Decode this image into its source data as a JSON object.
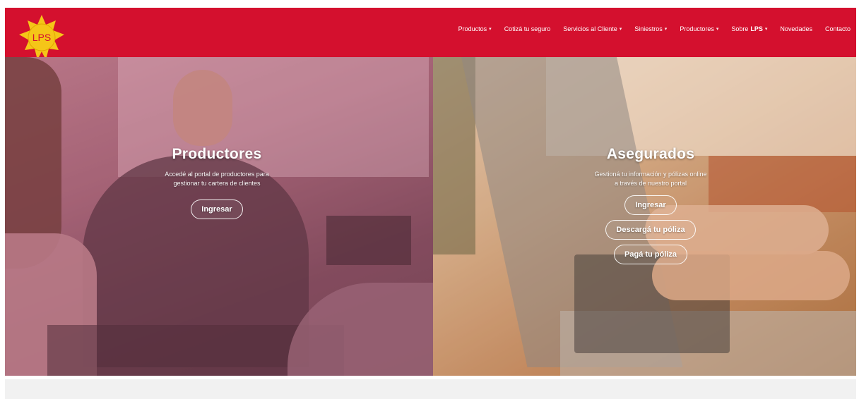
{
  "brand": {
    "logo_text": "LPS",
    "primary_color": "#d4102e",
    "logo_color": "#f5c518"
  },
  "nav": {
    "items": [
      {
        "label": "Productos",
        "dropdown": true
      },
      {
        "label": "Cotizá tu seguro",
        "dropdown": false
      },
      {
        "label": "Servicios al Cliente",
        "dropdown": true
      },
      {
        "label": "Siniestros",
        "dropdown": true
      },
      {
        "label": "Productores",
        "dropdown": true
      },
      {
        "label_prefix": "Sobre",
        "label_strong": "LPS",
        "dropdown": true
      },
      {
        "label": "Novedades",
        "dropdown": false
      },
      {
        "label": "Contacto",
        "dropdown": false
      }
    ],
    "caret": "▾"
  },
  "hero": {
    "left": {
      "title": "Productores",
      "subtitle_line1": "Accedé al portal de productores para",
      "subtitle_line2": "gestionar tu cartera de clientes",
      "button": "Ingresar"
    },
    "right": {
      "title": "Asegurados",
      "subtitle_line1": "Gestioná tu información y pólizas online",
      "subtitle_line2": "a través de nuestro portal",
      "buttons": [
        "Ingresar",
        "Descargá tu póliza",
        "Pagá tu póliza"
      ]
    }
  }
}
